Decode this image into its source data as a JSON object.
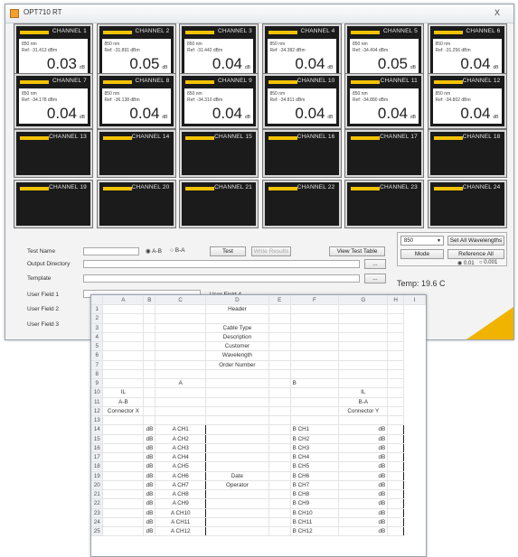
{
  "window": {
    "title": "OPT710 RT",
    "close_label": "X"
  },
  "channels": [
    {
      "name": "CHANNEL 1",
      "wavelength": "850 nm",
      "ref": "Ref: -31.413 dBm",
      "value": "0.03",
      "unit": "dB"
    },
    {
      "name": "CHANNEL 2",
      "wavelength": "850 nm",
      "ref": "Ref: -31.891 dBm",
      "value": "0.05",
      "unit": "dB"
    },
    {
      "name": "CHANNEL 3",
      "wavelength": "850 nm",
      "ref": "Ref: -31.442 dBm",
      "value": "0.04",
      "unit": "dB"
    },
    {
      "name": "CHANNEL 4",
      "wavelength": "850 nm",
      "ref": "Ref: -34.382 dBm",
      "value": "0.04",
      "unit": "dB"
    },
    {
      "name": "CHANNEL 5",
      "wavelength": "850 nm",
      "ref": "Ref: -34.494 dBm",
      "value": "0.05",
      "unit": "dB"
    },
    {
      "name": "CHANNEL 6",
      "wavelength": "850 nm",
      "ref": "Ref: -31.256 dBm",
      "value": "0.04",
      "unit": "dB"
    },
    {
      "name": "CHANNEL 7",
      "wavelength": "850 nm",
      "ref": "Ref: -34.178 dBm",
      "value": "0.04",
      "unit": "dB"
    },
    {
      "name": "CHANNEL 8",
      "wavelength": "850 nm",
      "ref": "Ref: -36.138 dBm",
      "value": "0.04",
      "unit": "dB"
    },
    {
      "name": "CHANNEL 9",
      "wavelength": "850 nm",
      "ref": "Ref: -34.310 dBm",
      "value": "0.04",
      "unit": "dB"
    },
    {
      "name": "CHANNEL 10",
      "wavelength": "850 nm",
      "ref": "Ref: -34.811 dBm",
      "value": "0.04",
      "unit": "dB"
    },
    {
      "name": "CHANNEL 11",
      "wavelength": "850 nm",
      "ref": "Ref: -34.880 dBm",
      "value": "0.04",
      "unit": "dB"
    },
    {
      "name": "CHANNEL 12",
      "wavelength": "850 nm",
      "ref": "Ref: -34.802 dBm",
      "value": "0.04",
      "unit": "dB"
    },
    {
      "name": "CHANNEL 13"
    },
    {
      "name": "CHANNEL 14"
    },
    {
      "name": "CHANNEL 15"
    },
    {
      "name": "CHANNEL 16"
    },
    {
      "name": "CHANNEL 17"
    },
    {
      "name": "CHANNEL 18"
    },
    {
      "name": "CHANNEL 19"
    },
    {
      "name": "CHANNEL 20"
    },
    {
      "name": "CHANNEL 21"
    },
    {
      "name": "CHANNEL 22"
    },
    {
      "name": "CHANNEL 23"
    },
    {
      "name": "CHANNEL 24"
    }
  ],
  "form": {
    "test_name_label": "Test Name",
    "output_dir_label": "Output Directory",
    "template_label": "Template",
    "user_field1_label": "User Field 1",
    "user_field2_label": "User Field 2",
    "user_field3_label": "User Field 3",
    "user_field4_label": "User Field 4",
    "radio_ab": "A-B",
    "radio_ba": "B-A",
    "test_button": "Test",
    "write_results_button": "Write Results",
    "view_test_table_button": "View Test Table",
    "browse_label": "...",
    "wavelength_select": "850",
    "set_all_button": "Set All Wavelengths",
    "mode_button": "Mode",
    "reference_all_button": "Reference All",
    "radio_001": "0.01",
    "radio_0001": "0.001",
    "temperature": "Temp: 19.6 C"
  },
  "sheet": {
    "columns": [
      "A",
      "B",
      "C",
      "D",
      "E",
      "F",
      "G",
      "H",
      "I"
    ],
    "rows": [
      [
        "1",
        "",
        "",
        "",
        "Header",
        "",
        "",
        "",
        ""
      ],
      [
        "2",
        "",
        "",
        "",
        "",
        "",
        "",
        "",
        ""
      ],
      [
        "3",
        "",
        "",
        "",
        "Cable Type",
        "",
        "",
        "",
        ""
      ],
      [
        "4",
        "",
        "",
        "",
        "Description",
        "",
        "",
        "",
        ""
      ],
      [
        "5",
        "",
        "",
        "",
        "Customer",
        "",
        "",
        "",
        ""
      ],
      [
        "6",
        "",
        "",
        "",
        "Wavelength",
        "",
        "",
        "",
        ""
      ],
      [
        "7",
        "",
        "",
        "",
        "Order Number",
        "",
        "",
        "",
        ""
      ],
      [
        "8",
        "",
        "",
        "",
        "",
        "",
        "",
        "",
        ""
      ],
      [
        "9",
        "",
        "",
        "A",
        "",
        "",
        "B",
        "",
        ""
      ],
      [
        "10",
        "IL",
        "",
        "",
        "",
        "",
        "",
        "IL",
        ""
      ],
      [
        "11",
        "A-B",
        "",
        "",
        "",
        "",
        "",
        "B-A",
        ""
      ],
      [
        "12",
        "Connector X",
        "",
        "",
        "",
        "",
        "",
        "Connector Y",
        ""
      ],
      [
        "13",
        "",
        "",
        "",
        "",
        "",
        "",
        "",
        ""
      ],
      [
        "14",
        "",
        "dB",
        "A CH1",
        "",
        "",
        "B CH1",
        "dB",
        ""
      ],
      [
        "15",
        "",
        "dB",
        "A CH2",
        "",
        "",
        "B CH2",
        "dB",
        ""
      ],
      [
        "16",
        "",
        "dB",
        "A CH3",
        "",
        "",
        "B CH3",
        "dB",
        ""
      ],
      [
        "17",
        "",
        "dB",
        "A CH4",
        "",
        "",
        "B CH4",
        "dB",
        ""
      ],
      [
        "18",
        "",
        "dB",
        "A CH5",
        "",
        "",
        "B CH5",
        "dB",
        ""
      ],
      [
        "19",
        "",
        "dB",
        "A CH6",
        "Date",
        "",
        "B CH6",
        "dB",
        ""
      ],
      [
        "20",
        "",
        "dB",
        "A CH7",
        "Operator",
        "",
        "B CH7",
        "dB",
        ""
      ],
      [
        "21",
        "",
        "dB",
        "A CH8",
        "",
        "",
        "B CH8",
        "dB",
        ""
      ],
      [
        "22",
        "",
        "dB",
        "A CH9",
        "",
        "",
        "B CH9",
        "dB",
        ""
      ],
      [
        "23",
        "",
        "dB",
        "A CH10",
        "",
        "",
        "B CH10",
        "dB",
        ""
      ],
      [
        "24",
        "",
        "dB",
        "A CH11",
        "",
        "",
        "B CH11",
        "dB",
        ""
      ],
      [
        "25",
        "",
        "dB",
        "A CH12",
        "",
        "",
        "B CH12",
        "dB",
        ""
      ]
    ]
  },
  "colors": {
    "accent_yellow": "#f2c200",
    "tile_dark": "#1b1b1b"
  }
}
